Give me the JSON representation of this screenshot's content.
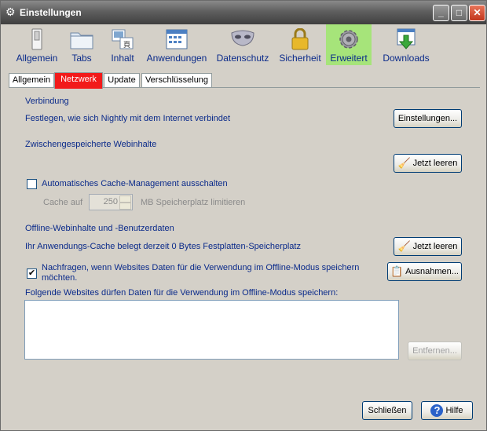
{
  "window": {
    "title": "Einstellungen",
    "icon": "gear-icon",
    "controls": {
      "minimize": "_",
      "maximize": "□",
      "close": "✕"
    }
  },
  "toolbar": {
    "panes": [
      {
        "label": "Allgemein",
        "icon": "switch-icon"
      },
      {
        "label": "Tabs",
        "icon": "folder-tabs-icon"
      },
      {
        "label": "Inhalt",
        "icon": "content-icon"
      },
      {
        "label": "Anwendungen",
        "icon": "applications-icon"
      },
      {
        "label": "Datenschutz",
        "icon": "mask-icon"
      },
      {
        "label": "Sicherheit",
        "icon": "padlock-icon"
      },
      {
        "label": "Erweitert",
        "icon": "gear-icon",
        "selected": true
      },
      {
        "label": "Downloads",
        "icon": "download-icon"
      }
    ]
  },
  "subtabs": [
    {
      "label": "Allgemein"
    },
    {
      "label": "Netzwerk",
      "active": true
    },
    {
      "label": "Update"
    },
    {
      "label": "Verschlüsselung"
    }
  ],
  "connection": {
    "heading": "Verbindung",
    "description": "Festlegen, wie sich Nightly mit dem Internet verbindet",
    "settings_button": "Einstellungen..."
  },
  "cache": {
    "heading": "Zwischengespeicherte Webinhalte",
    "clear_button": "Jetzt leeren",
    "auto_checkbox_label": "Automatisches Cache-Management ausschalten",
    "auto_checked": false,
    "limit_label": "Cache auf",
    "limit_value": "250",
    "limit_unit": "MB Speicherplatz limitieren"
  },
  "offline": {
    "heading": "Offline-Webinhalte und -Benutzerdaten",
    "usage_text": "Ihr Anwendungs-Cache belegt derzeit 0 Bytes Festplatten-Speicherplatz",
    "clear_button": "Jetzt leeren",
    "ask_checkbox_line1": "Nachfragen, wenn Websites Daten für die Verwendung im Offline-Modus speichern",
    "ask_checkbox_line2": "möchten.",
    "ask_checked": true,
    "exceptions_button": "Ausnahmen...",
    "list_label": "Folgende Websites dürfen Daten für die Verwendung im Offline-Modus speichern:",
    "remove_button": "Entfernen..."
  },
  "footer": {
    "close_button": "Schließen",
    "help_button": "Hilfe"
  },
  "colors": {
    "selected_pane": "#a6e47a",
    "active_tab": "#f21a1a",
    "label_blue": "#0a2a8a",
    "dialog_bg": "#d4d0c8"
  }
}
